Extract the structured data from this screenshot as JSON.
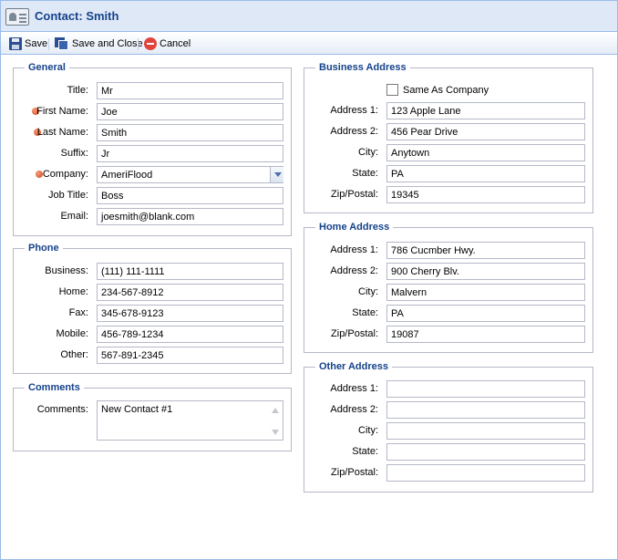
{
  "window": {
    "title": "Contact: Smith",
    "icon": "contact-card-icon"
  },
  "toolbar": {
    "save": "Save",
    "save_close": "Save and Close",
    "cancel": "Cancel"
  },
  "general": {
    "legend": "General",
    "title_label": "Title:",
    "title": "Mr",
    "first_label": "First Name:",
    "first": "Joe",
    "last_label": "Last Name:",
    "last": "Smith",
    "suffix_label": "Suffix:",
    "suffix": "Jr",
    "company_label": "Company:",
    "company": "AmeriFlood",
    "job_label": "Job Title:",
    "job": "Boss",
    "email_label": "Email:",
    "email": "joesmith@blank.com"
  },
  "phone": {
    "legend": "Phone",
    "business_label": "Business:",
    "business": "(111) 111-1111",
    "home_label": "Home:",
    "home": "234-567-8912",
    "fax_label": "Fax:",
    "fax": "345-678-9123",
    "mobile_label": "Mobile:",
    "mobile": "456-789-1234",
    "other_label": "Other:",
    "other": "567-891-2345"
  },
  "comments": {
    "legend": "Comments",
    "label": "Comments:",
    "value": "New Contact #1"
  },
  "business_address": {
    "legend": "Business Address",
    "same_as_company": "Same As Company",
    "address1_label": "Address 1:",
    "address1": "123 Apple Lane",
    "address2_label": "Address 2:",
    "address2": "456 Pear Drive",
    "city_label": "City:",
    "city": "Anytown",
    "state_label": "State:",
    "state": "PA",
    "zip_label": "Zip/Postal:",
    "zip": "19345"
  },
  "home_address": {
    "legend": "Home Address",
    "address1_label": "Address 1:",
    "address1": "786 Cucmber Hwy.",
    "address2_label": "Address 2:",
    "address2": "900 Cherry Blv.",
    "city_label": "City:",
    "city": "Malvern",
    "state_label": "State:",
    "state": "PA",
    "zip_label": "Zip/Postal:",
    "zip": "19087"
  },
  "other_address": {
    "legend": "Other Address",
    "address1_label": "Address 1:",
    "address1": "",
    "address2_label": "Address 2:",
    "address2": "",
    "city_label": "City:",
    "city": "",
    "state_label": "State:",
    "state": "",
    "zip_label": "Zip/Postal:",
    "zip": ""
  },
  "colors": {
    "title_text": "#15428b",
    "header_bg": "#dfe8f6",
    "border": "#99bbe8",
    "required_dot": "#d4461b"
  }
}
